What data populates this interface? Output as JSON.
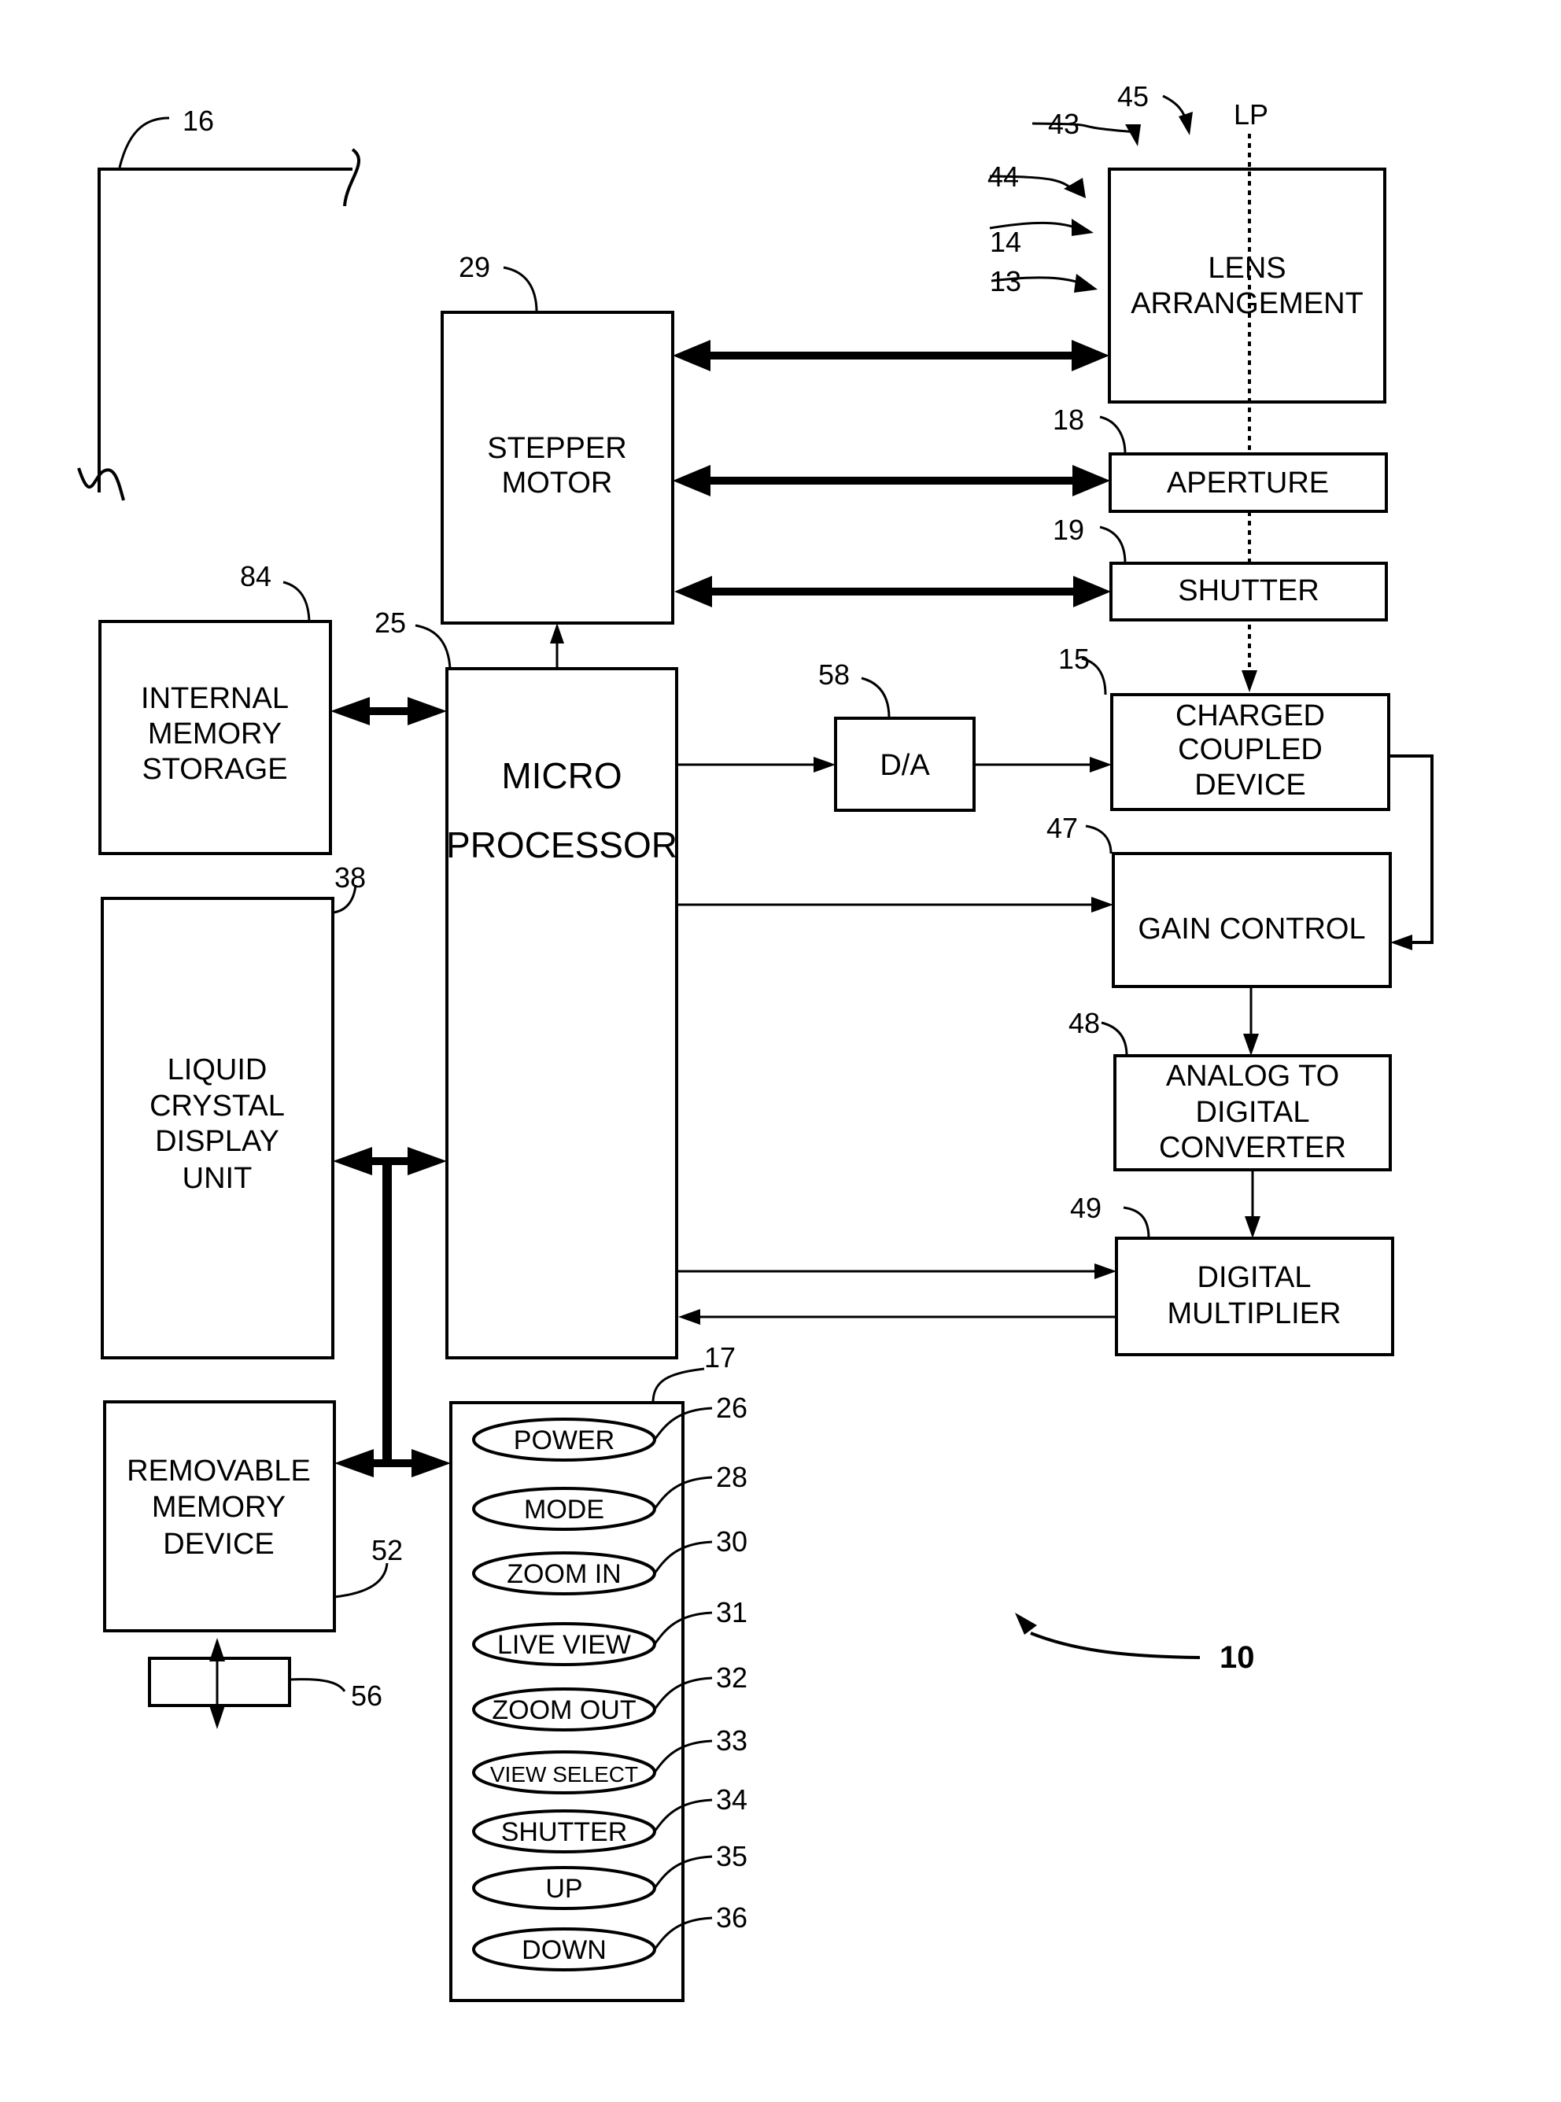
{
  "figure": {
    "number": "10",
    "optical_path_label": "LP"
  },
  "blocks": {
    "lens": {
      "ref": "13",
      "lines": [
        "LENS",
        "ARRANGEMENT"
      ],
      "extra_refs": [
        "14",
        "44",
        "43",
        "45"
      ]
    },
    "aperture": {
      "ref": "18",
      "lines": [
        "APERTURE"
      ]
    },
    "shutter": {
      "ref": "19",
      "lines": [
        "SHUTTER"
      ]
    },
    "ccd": {
      "ref": "15",
      "lines": [
        "CHARGED",
        "COUPLED",
        "DEVICE"
      ]
    },
    "gain": {
      "ref": "47",
      "lines": [
        "GAIN CONTROL"
      ]
    },
    "adc": {
      "ref": "48",
      "lines": [
        "ANALOG TO",
        "DIGITAL",
        "CONVERTER"
      ]
    },
    "multiplier": {
      "ref": "49",
      "lines": [
        "DIGITAL",
        "MULTIPLIER"
      ]
    },
    "da": {
      "ref": "58",
      "lines": [
        "D/A"
      ]
    },
    "stepper": {
      "ref": "29",
      "lines": [
        "STEPPER",
        "MOTOR"
      ]
    },
    "cpu": {
      "ref": "25",
      "lines": [
        "MICRO",
        "PROCESSOR"
      ]
    },
    "internal_memory": {
      "ref": "84",
      "lines": [
        "INTERNAL",
        "MEMORY",
        "STORAGE"
      ]
    },
    "lcd": {
      "ref": "38",
      "lines": [
        "LIQUID",
        "CRYSTAL",
        "DISPLAY",
        "UNIT"
      ]
    },
    "removable_memory": {
      "ref": "52",
      "lines": [
        "REMOVABLE",
        "MEMORY",
        "DEVICE"
      ]
    },
    "card": {
      "ref": "56"
    },
    "housing": {
      "ref": "16"
    },
    "control_panel": {
      "ref": "17"
    }
  },
  "buttons": [
    {
      "label": "POWER",
      "ref": "26"
    },
    {
      "label": "MODE",
      "ref": "28"
    },
    {
      "label": "ZOOM IN",
      "ref": "30"
    },
    {
      "label": "LIVE VIEW",
      "ref": "31"
    },
    {
      "label": "ZOOM OUT",
      "ref": "32"
    },
    {
      "label": "VIEW SELECT",
      "ref": "33"
    },
    {
      "label": "SHUTTER",
      "ref": "34"
    },
    {
      "label": "UP",
      "ref": "35"
    },
    {
      "label": "DOWN",
      "ref": "36"
    }
  ]
}
